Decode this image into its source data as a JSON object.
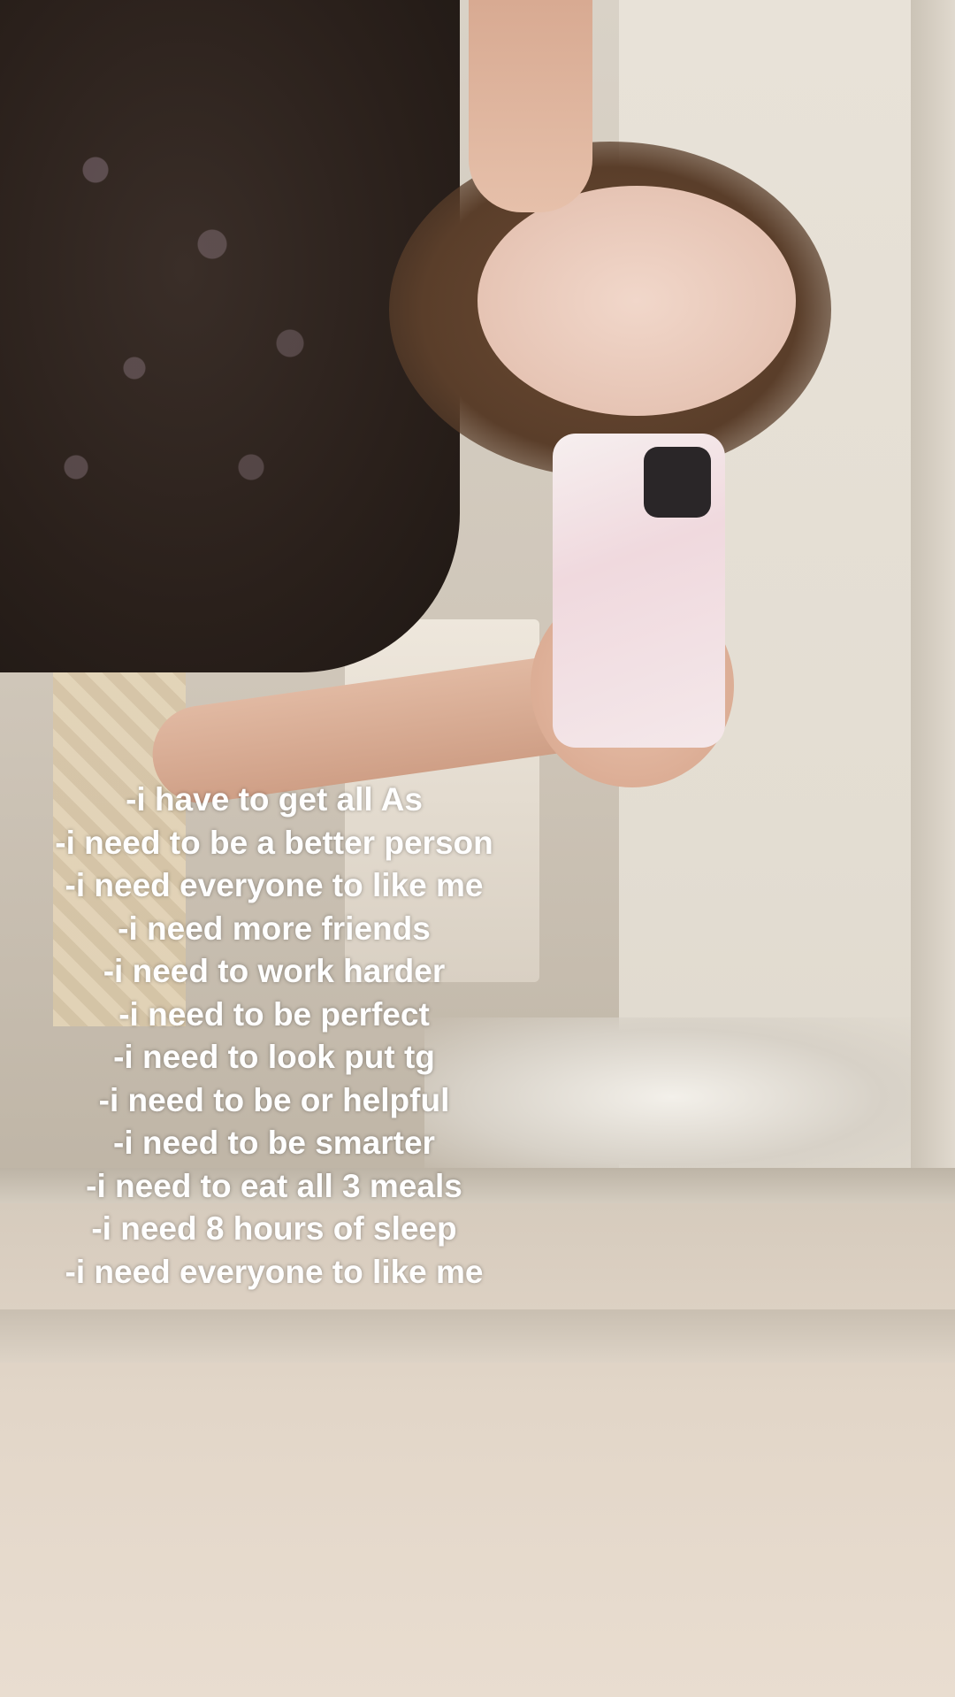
{
  "caption": {
    "lines": [
      "-i have to get all As",
      "-i need to be a better person",
      "-i need everyone to like me",
      "-i need more friends",
      "-i need to work harder",
      "-i need to be perfect",
      "-i need to look put tg",
      "-i need to be or helpful",
      "-i need to be smarter",
      "-i need to eat all 3 meals",
      "-i need 8 hours of sleep",
      "-i need everyone to like me"
    ]
  }
}
